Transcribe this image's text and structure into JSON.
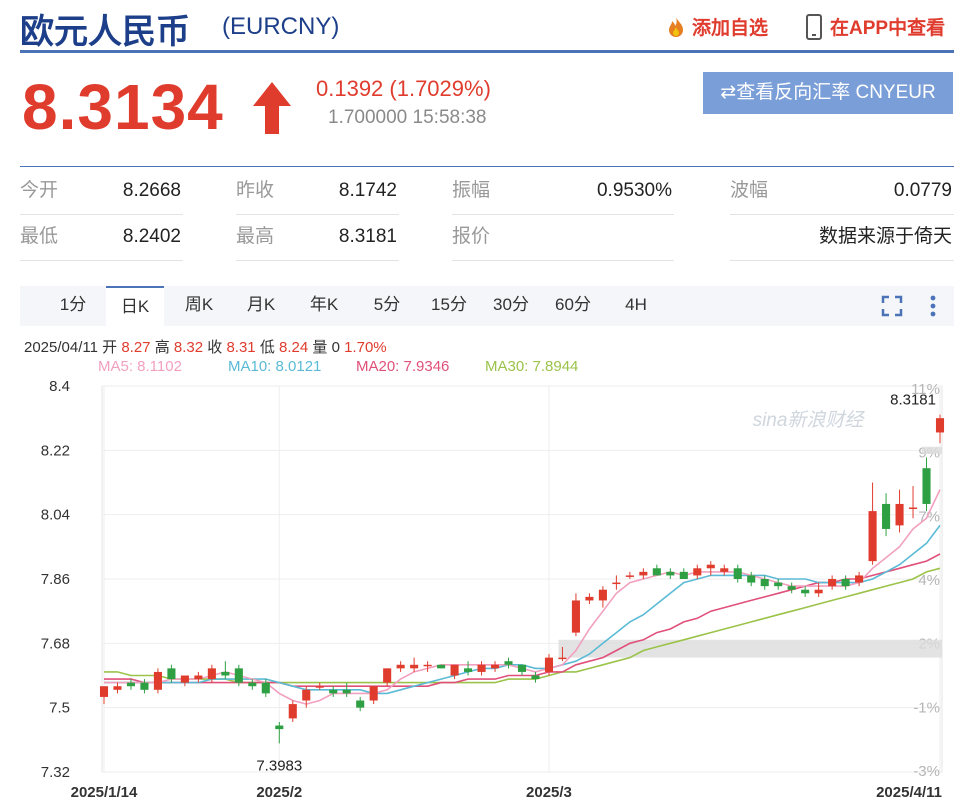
{
  "header": {
    "title": "欧元人民币",
    "code": "(EURCNY)",
    "add_watch": "添加自选",
    "app_view": "在APP中查看"
  },
  "quote": {
    "price": "8.3134",
    "change": "0.1392 (1.7029%)",
    "sub": "1.700000 15:58:38",
    "reverse_button": "⇄查看反向汇率 CNYEUR"
  },
  "stats": {
    "open_label": "今开",
    "open": "8.2668",
    "prev_label": "昨收",
    "prev": "8.1742",
    "amp_label": "振幅",
    "amp": "0.9530%",
    "wave_label": "波幅",
    "wave": "0.0779",
    "low_label": "最低",
    "low": "8.2402",
    "high_label": "最高",
    "high": "8.3181",
    "quote_label": "报价",
    "source": "数据来源于倚天"
  },
  "tabs": [
    "1分",
    "日K",
    "周K",
    "月K",
    "年K",
    "5分",
    "15分",
    "30分",
    "60分",
    "4H"
  ],
  "active_tab": 1,
  "bar_info": {
    "date": "2025/04/11",
    "open_label": "开",
    "open": "8.27",
    "high_label": "高",
    "high": "8.32",
    "close_label": "收",
    "close": "8.31",
    "low_label": "低",
    "low": "8.24",
    "vol_label": "量",
    "vol": "0",
    "pct": "1.70%"
  },
  "ma_legend": [
    {
      "text": "MA5: 8.1102",
      "color": "#f2a0bf"
    },
    {
      "text": "MA10: 8.0121",
      "color": "#5bbad5"
    },
    {
      "text": "MA20: 7.9346",
      "color": "#e0507a"
    },
    {
      "text": "MA30: 7.8944",
      "color": "#9bc34a"
    }
  ],
  "colors": {
    "up": "#e03c2e",
    "down": "#2ea043",
    "accent": "#4a73b8"
  },
  "chart_data": {
    "type": "candlestick",
    "y_ticks": [
      "8.4",
      "8.22",
      "8.04",
      "7.86",
      "7.68",
      "7.5",
      "7.32"
    ],
    "ylim": [
      7.32,
      8.4
    ],
    "pct_ticks": [
      "11%",
      "9%",
      "7%",
      "4%",
      "2%",
      "-1%",
      "-3%"
    ],
    "x_labels": [
      "2025/1/14",
      "2025/2",
      "2025/3",
      "2025/4/11"
    ],
    "x_label_index": [
      0,
      13,
      33,
      62
    ],
    "max_label": "8.3181",
    "min_label": "7.3983",
    "watermark": "sina新浪财经",
    "candles": [
      {
        "date": "2025/1/14",
        "o": 7.53,
        "h": 7.56,
        "l": 7.51,
        "c": 7.56
      },
      {
        "date": "2025/1/15",
        "o": 7.55,
        "h": 7.57,
        "l": 7.54,
        "c": 7.56
      },
      {
        "date": "2025/1/16",
        "o": 7.57,
        "h": 7.58,
        "l": 7.55,
        "c": 7.56
      },
      {
        "date": "2025/1/17",
        "o": 7.57,
        "h": 7.58,
        "l": 7.54,
        "c": 7.55
      },
      {
        "date": "2025/1/20",
        "o": 7.55,
        "h": 7.61,
        "l": 7.54,
        "c": 7.6
      },
      {
        "date": "2025/1/21",
        "o": 7.61,
        "h": 7.62,
        "l": 7.57,
        "c": 7.58
      },
      {
        "date": "2025/1/22",
        "o": 7.57,
        "h": 7.59,
        "l": 7.56,
        "c": 7.59
      },
      {
        "date": "2025/1/23",
        "o": 7.58,
        "h": 7.6,
        "l": 7.57,
        "c": 7.59
      },
      {
        "date": "2025/1/24",
        "o": 7.58,
        "h": 7.62,
        "l": 7.57,
        "c": 7.61
      },
      {
        "date": "2025/1/27",
        "o": 7.6,
        "h": 7.63,
        "l": 7.58,
        "c": 7.59
      },
      {
        "date": "2025/1/28",
        "o": 7.61,
        "h": 7.62,
        "l": 7.56,
        "c": 7.57
      },
      {
        "date": "2025/1/29",
        "o": 7.57,
        "h": 7.58,
        "l": 7.55,
        "c": 7.56
      },
      {
        "date": "2025/1/30",
        "o": 7.57,
        "h": 7.58,
        "l": 7.53,
        "c": 7.54
      },
      {
        "date": "2025/2/3",
        "o": 7.45,
        "h": 7.46,
        "l": 7.4,
        "c": 7.44
      },
      {
        "date": "2025/2/4",
        "o": 7.47,
        "h": 7.52,
        "l": 7.46,
        "c": 7.51
      },
      {
        "date": "2025/2/5",
        "o": 7.52,
        "h": 7.56,
        "l": 7.5,
        "c": 7.55
      },
      {
        "date": "2025/2/6",
        "o": 7.56,
        "h": 7.57,
        "l": 7.55,
        "c": 7.56
      },
      {
        "date": "2025/2/7",
        "o": 7.55,
        "h": 7.56,
        "l": 7.53,
        "c": 7.54
      },
      {
        "date": "2025/2/10",
        "o": 7.55,
        "h": 7.57,
        "l": 7.53,
        "c": 7.54
      },
      {
        "date": "2025/2/11",
        "o": 7.52,
        "h": 7.53,
        "l": 7.49,
        "c": 7.5
      },
      {
        "date": "2025/2/12",
        "o": 7.52,
        "h": 7.56,
        "l": 7.51,
        "c": 7.56
      },
      {
        "date": "2025/2/13",
        "o": 7.57,
        "h": 7.61,
        "l": 7.56,
        "c": 7.61
      },
      {
        "date": "2025/2/14",
        "o": 7.61,
        "h": 7.63,
        "l": 7.6,
        "c": 7.62
      },
      {
        "date": "2025/2/17",
        "o": 7.61,
        "h": 7.64,
        "l": 7.6,
        "c": 7.62
      },
      {
        "date": "2025/2/18",
        "o": 7.62,
        "h": 7.63,
        "l": 7.6,
        "c": 7.62
      },
      {
        "date": "2025/2/19",
        "o": 7.62,
        "h": 7.62,
        "l": 7.61,
        "c": 7.61
      },
      {
        "date": "2025/2/20",
        "o": 7.59,
        "h": 7.62,
        "l": 7.58,
        "c": 7.62
      },
      {
        "date": "2025/2/21",
        "o": 7.61,
        "h": 7.63,
        "l": 7.59,
        "c": 7.6
      },
      {
        "date": "2025/2/24",
        "o": 7.6,
        "h": 7.63,
        "l": 7.59,
        "c": 7.62
      },
      {
        "date": "2025/2/25",
        "o": 7.61,
        "h": 7.63,
        "l": 7.6,
        "c": 7.62
      },
      {
        "date": "2025/2/26",
        "o": 7.63,
        "h": 7.64,
        "l": 7.61,
        "c": 7.62
      },
      {
        "date": "2025/2/27",
        "o": 7.62,
        "h": 7.62,
        "l": 7.59,
        "c": 7.6
      },
      {
        "date": "2025/2/28",
        "o": 7.59,
        "h": 7.6,
        "l": 7.57,
        "c": 7.58
      },
      {
        "date": "2025/3/3",
        "o": 7.6,
        "h": 7.65,
        "l": 7.59,
        "c": 7.64
      },
      {
        "date": "2025/3/4",
        "o": 7.64,
        "h": 7.67,
        "l": 7.63,
        "c": 7.64
      },
      {
        "date": "2025/3/5",
        "o": 7.71,
        "h": 7.82,
        "l": 7.7,
        "c": 7.8
      },
      {
        "date": "2025/3/6",
        "o": 7.8,
        "h": 7.82,
        "l": 7.79,
        "c": 7.81
      },
      {
        "date": "2025/3/7",
        "o": 7.8,
        "h": 7.84,
        "l": 7.78,
        "c": 7.83
      },
      {
        "date": "2025/3/10",
        "o": 7.85,
        "h": 7.87,
        "l": 7.83,
        "c": 7.85
      },
      {
        "date": "2025/3/11",
        "o": 7.87,
        "h": 7.88,
        "l": 7.86,
        "c": 7.87
      },
      {
        "date": "2025/3/12",
        "o": 7.87,
        "h": 7.89,
        "l": 7.86,
        "c": 7.88
      },
      {
        "date": "2025/3/13",
        "o": 7.89,
        "h": 7.9,
        "l": 7.87,
        "c": 7.87
      },
      {
        "date": "2025/3/14",
        "o": 7.88,
        "h": 7.89,
        "l": 7.86,
        "c": 7.87
      },
      {
        "date": "2025/3/17",
        "o": 7.88,
        "h": 7.89,
        "l": 7.86,
        "c": 7.86
      },
      {
        "date": "2025/3/18",
        "o": 7.87,
        "h": 7.9,
        "l": 7.86,
        "c": 7.89
      },
      {
        "date": "2025/3/19",
        "o": 7.89,
        "h": 7.91,
        "l": 7.87,
        "c": 7.9
      },
      {
        "date": "2025/3/20",
        "o": 7.88,
        "h": 7.9,
        "l": 7.87,
        "c": 7.89
      },
      {
        "date": "2025/3/21",
        "o": 7.89,
        "h": 7.9,
        "l": 7.85,
        "c": 7.86
      },
      {
        "date": "2025/3/24",
        "o": 7.87,
        "h": 7.88,
        "l": 7.84,
        "c": 7.85
      },
      {
        "date": "2025/3/25",
        "o": 7.86,
        "h": 7.87,
        "l": 7.83,
        "c": 7.84
      },
      {
        "date": "2025/3/26",
        "o": 7.85,
        "h": 7.86,
        "l": 7.83,
        "c": 7.84
      },
      {
        "date": "2025/3/27",
        "o": 7.84,
        "h": 7.85,
        "l": 7.82,
        "c": 7.83
      },
      {
        "date": "2025/3/28",
        "o": 7.83,
        "h": 7.84,
        "l": 7.81,
        "c": 7.82
      },
      {
        "date": "2025/3/31",
        "o": 7.82,
        "h": 7.85,
        "l": 7.81,
        "c": 7.83
      },
      {
        "date": "2025/4/1",
        "o": 7.84,
        "h": 7.87,
        "l": 7.83,
        "c": 7.86
      },
      {
        "date": "2025/4/2",
        "o": 7.86,
        "h": 7.87,
        "l": 7.83,
        "c": 7.84
      },
      {
        "date": "2025/4/3",
        "o": 7.85,
        "h": 7.88,
        "l": 7.84,
        "c": 7.87
      },
      {
        "date": "2025/4/4",
        "o": 7.91,
        "h": 8.13,
        "l": 7.9,
        "c": 8.05
      },
      {
        "date": "2025/4/7",
        "o": 8.07,
        "h": 8.1,
        "l": 7.98,
        "c": 8.0
      },
      {
        "date": "2025/4/8",
        "o": 8.01,
        "h": 8.11,
        "l": 7.99,
        "c": 8.07
      },
      {
        "date": "2025/4/9",
        "o": 8.06,
        "h": 8.12,
        "l": 8.03,
        "c": 8.06
      },
      {
        "date": "2025/4/10",
        "o": 8.17,
        "h": 8.2,
        "l": 8.05,
        "c": 8.07
      },
      {
        "date": "2025/4/11",
        "o": 8.27,
        "h": 8.32,
        "l": 8.24,
        "c": 8.31
      }
    ],
    "ma5": [
      7.57,
      7.57,
      7.57,
      7.57,
      7.57,
      7.58,
      7.58,
      7.58,
      7.59,
      7.6,
      7.59,
      7.58,
      7.57,
      7.54,
      7.52,
      7.51,
      7.52,
      7.54,
      7.54,
      7.54,
      7.54,
      7.55,
      7.58,
      7.6,
      7.61,
      7.62,
      7.62,
      7.62,
      7.62,
      7.62,
      7.62,
      7.61,
      7.6,
      7.61,
      7.62,
      7.66,
      7.72,
      7.77,
      7.82,
      7.85,
      7.86,
      7.87,
      7.88,
      7.87,
      7.88,
      7.88,
      7.88,
      7.88,
      7.87,
      7.86,
      7.85,
      7.84,
      7.84,
      7.84,
      7.84,
      7.84,
      7.85,
      7.89,
      7.92,
      7.95,
      8.0,
      8.03,
      8.11
    ],
    "ma10": [
      7.57,
      7.57,
      7.57,
      7.57,
      7.57,
      7.57,
      7.57,
      7.57,
      7.58,
      7.58,
      7.58,
      7.58,
      7.58,
      7.57,
      7.56,
      7.55,
      7.55,
      7.55,
      7.55,
      7.55,
      7.54,
      7.54,
      7.55,
      7.56,
      7.57,
      7.58,
      7.59,
      7.6,
      7.61,
      7.61,
      7.62,
      7.62,
      7.61,
      7.61,
      7.62,
      7.63,
      7.65,
      7.68,
      7.71,
      7.74,
      7.76,
      7.79,
      7.82,
      7.85,
      7.86,
      7.87,
      7.87,
      7.87,
      7.87,
      7.87,
      7.86,
      7.86,
      7.86,
      7.85,
      7.85,
      7.85,
      7.85,
      7.86,
      7.88,
      7.9,
      7.93,
      7.96,
      8.01
    ],
    "ma20": [
      7.58,
      7.58,
      7.58,
      7.57,
      7.57,
      7.57,
      7.57,
      7.57,
      7.57,
      7.57,
      7.57,
      7.57,
      7.57,
      7.57,
      7.56,
      7.56,
      7.56,
      7.56,
      7.56,
      7.56,
      7.56,
      7.56,
      7.56,
      7.56,
      7.56,
      7.57,
      7.57,
      7.58,
      7.58,
      7.58,
      7.59,
      7.59,
      7.59,
      7.6,
      7.6,
      7.62,
      7.63,
      7.64,
      7.66,
      7.68,
      7.69,
      7.71,
      7.72,
      7.74,
      7.75,
      7.77,
      7.78,
      7.79,
      7.8,
      7.81,
      7.82,
      7.83,
      7.84,
      7.85,
      7.85,
      7.86,
      7.86,
      7.87,
      7.88,
      7.89,
      7.9,
      7.91,
      7.93
    ],
    "ma30": [
      7.6,
      7.6,
      7.59,
      7.59,
      7.59,
      7.58,
      7.58,
      7.58,
      7.58,
      7.58,
      7.57,
      7.57,
      7.57,
      7.57,
      7.57,
      7.57,
      7.57,
      7.57,
      7.57,
      7.57,
      7.57,
      7.57,
      7.57,
      7.57,
      7.57,
      7.57,
      7.57,
      7.57,
      7.57,
      7.57,
      7.58,
      7.58,
      7.58,
      7.59,
      7.6,
      7.6,
      7.61,
      7.62,
      7.63,
      7.64,
      7.66,
      7.67,
      7.68,
      7.69,
      7.7,
      7.71,
      7.72,
      7.73,
      7.74,
      7.75,
      7.76,
      7.77,
      7.78,
      7.79,
      7.8,
      7.81,
      7.82,
      7.83,
      7.84,
      7.85,
      7.86,
      7.88,
      7.89
    ]
  }
}
